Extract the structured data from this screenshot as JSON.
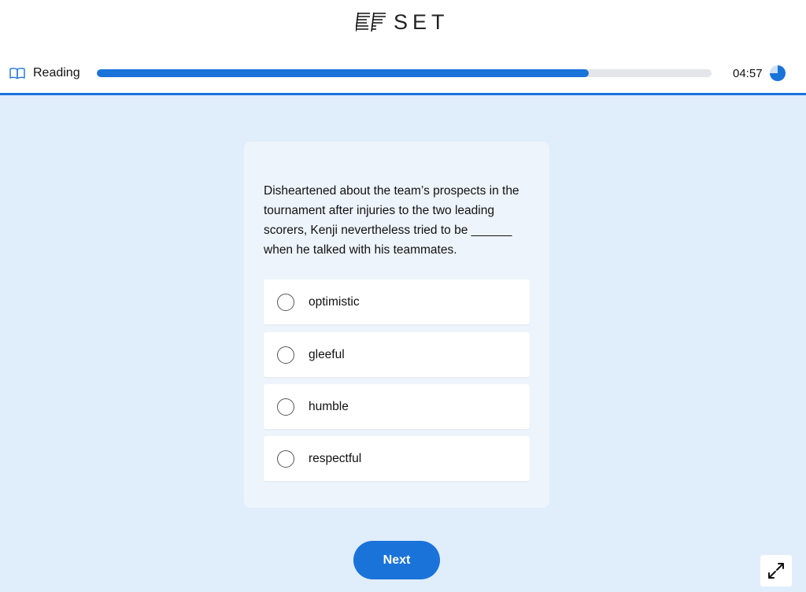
{
  "header": {
    "logo": {
      "mark": "EF",
      "text": "SET"
    },
    "section": {
      "icon": "book-icon",
      "label": "Reading"
    },
    "progress": {
      "fraction": 0.8
    },
    "timer": {
      "text": "04:57",
      "icon": "pie-timer-icon",
      "remaining_fraction": 0.75
    }
  },
  "question": {
    "text": "Disheartened about the team’s prospects in the tournament after injuries to the two leading scorers, Kenji nevertheless tried to be ______ when he talked with his teammates.",
    "options": [
      {
        "label": "optimistic"
      },
      {
        "label": "gleeful"
      },
      {
        "label": "humble"
      },
      {
        "label": "respectful"
      }
    ]
  },
  "footer": {
    "next_label": "Next",
    "expand_icon": "expand-icon"
  },
  "colors": {
    "accent": "#1a73d9",
    "background": "#e0edfb",
    "card": "#eef4fb"
  }
}
